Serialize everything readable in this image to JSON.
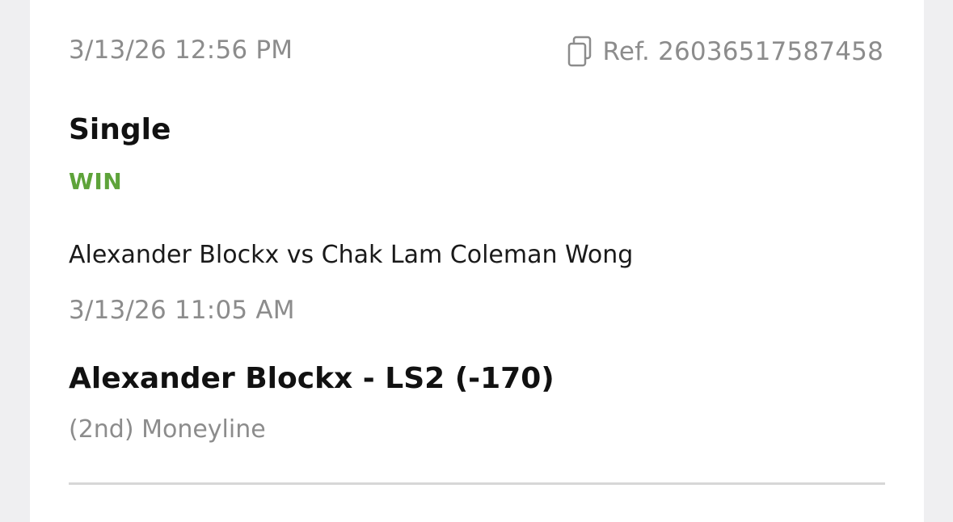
{
  "bet": {
    "placed_at": "3/13/26 12:56 PM",
    "reference": "Ref. 26036517587458",
    "type": "Single",
    "result": "WIN",
    "event_name": "Alexander Blockx vs Chak Lam Coleman Wong",
    "event_time": "3/13/26 11:05 AM",
    "selection": "Alexander Blockx - LS2 (-170)",
    "market": "(2nd) Moneyline"
  },
  "colors": {
    "result_win": "#5ea33a",
    "muted_text": "#8c8c8c",
    "primary_text": "#111111",
    "background": "#efeff1",
    "card": "#ffffff"
  },
  "icons": {
    "copy": "copy-icon"
  }
}
